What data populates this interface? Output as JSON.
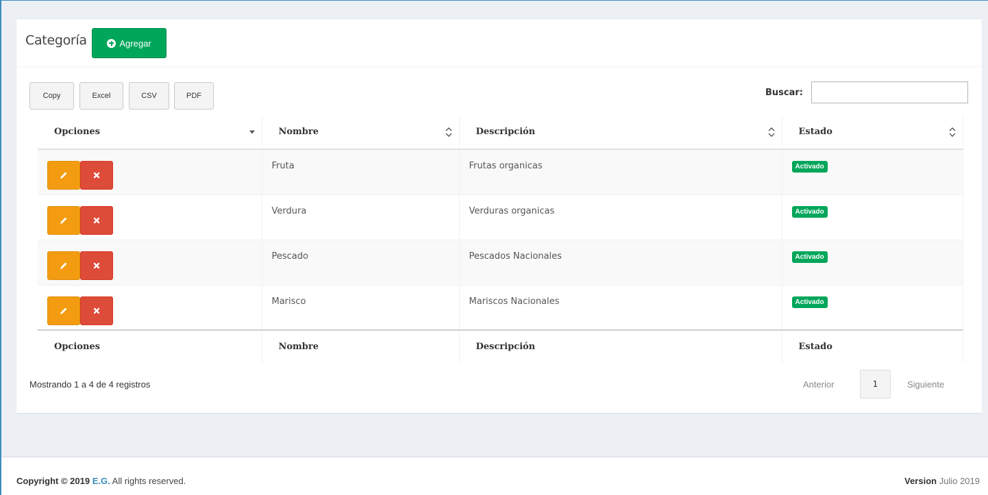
{
  "header": {
    "title": "Categoría",
    "add_button_label": "Agregar"
  },
  "toolbar": {
    "export_buttons": [
      "Copy",
      "Excel",
      "CSV",
      "PDF"
    ],
    "search_label": "Buscar:",
    "search_value": ""
  },
  "table": {
    "columns": [
      "Opciones",
      "Nombre",
      "Descripción",
      "Estado"
    ],
    "rows": [
      {
        "nombre": "Fruta",
        "descripcion": "Frutas organicas",
        "estado": "Activado"
      },
      {
        "nombre": "Verdura",
        "descripcion": "Verduras organicas",
        "estado": "Activado"
      },
      {
        "nombre": "Pescado",
        "descripcion": "Pescados Nacionales",
        "estado": "Activado"
      },
      {
        "nombre": "Marisco",
        "descripcion": "Mariscos Nacionales",
        "estado": "Activado"
      }
    ]
  },
  "pagination": {
    "info": "Mostrando 1 a 4 de 4 registros",
    "previous": "Anterior",
    "current_page": "1",
    "next": "Siguiente"
  },
  "footer": {
    "copyright_prefix": "Copyright © 2019",
    "brand": "E.G.",
    "rights": "All rights reserved.",
    "version_label": "Version",
    "version_value": "Julio 2019"
  },
  "colors": {
    "success": "#00a65a",
    "warning": "#f39c12",
    "danger": "#dd4b39",
    "link": "#3c8dbc"
  }
}
